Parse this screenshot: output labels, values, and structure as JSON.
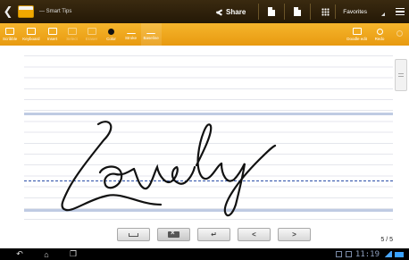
{
  "topbar": {
    "title": "— Smart Tips",
    "share_label": "Share",
    "favorites_label": "Favorites"
  },
  "toolbar": {
    "tools": [
      {
        "label": "Scribble",
        "icon": "scribble-icon",
        "enabled": true,
        "active": false
      },
      {
        "label": "Keyboard",
        "icon": "keyboard-icon",
        "enabled": true,
        "active": false
      },
      {
        "label": "Insert",
        "icon": "insert-icon",
        "enabled": true,
        "active": false
      },
      {
        "label": "Select",
        "icon": "select-icon",
        "enabled": false,
        "active": false
      },
      {
        "label": "Eraser",
        "icon": "eraser-icon",
        "enabled": false,
        "active": false
      },
      {
        "label": "Color",
        "icon": "color-icon",
        "enabled": true,
        "active": false
      },
      {
        "label": "Stroke",
        "icon": "stroke-icon",
        "enabled": true,
        "active": false
      },
      {
        "label": "Baseline",
        "icon": "baseline-icon",
        "enabled": true,
        "active": true
      }
    ],
    "right_tools": [
      {
        "label": "Doodle edit",
        "icon": "doodle-edit-icon",
        "enabled": true
      },
      {
        "label": "Redo",
        "icon": "redo-icon",
        "enabled": true
      },
      {
        "label": "",
        "icon": "undo-icon",
        "enabled": false
      }
    ]
  },
  "note": {
    "handwritten_text": "Lovely",
    "page_indicator": "5 / 5"
  },
  "keys": [
    {
      "name": "space-key"
    },
    {
      "name": "backspace-key"
    },
    {
      "name": "enter-key",
      "glyph": "↵"
    },
    {
      "name": "prev-key",
      "glyph": "<"
    },
    {
      "name": "next-key",
      "glyph": ">"
    }
  ],
  "statusbar": {
    "time": "11:19"
  },
  "colors": {
    "toolbar_orange": "#f0a81f",
    "top_bar": "#2f2210",
    "baseline_blue": "#2b4fa8"
  }
}
